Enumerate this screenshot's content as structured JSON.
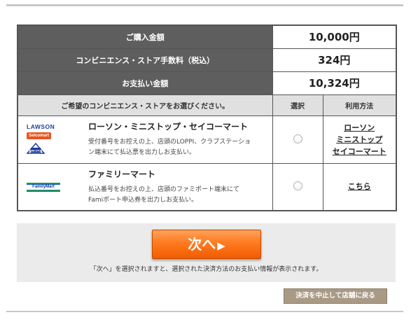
{
  "summary": {
    "purchase_label": "ご購入金額",
    "purchase_value": "10,000円",
    "fee_label": "コンビニエンス・ストア手数料（税込）",
    "fee_value": "324円",
    "total_label": "お支払い金額",
    "total_value": "10,324円"
  },
  "store_table": {
    "header_store": "ご希望のコンビニエンス・ストアをお選びください。",
    "header_select": "選択",
    "header_method": "利用方法",
    "rows": [
      {
        "logos": [
          "LAWSON",
          "Seicomart",
          "MINI STOP"
        ],
        "name": "ローソン・ミニストップ・セイコーマート",
        "desc_line1": "受付番号をお控えの上、店頭のLOPPI、クラブステーショ",
        "desc_line2": "ン端末にて払込票を出力しお支払い。",
        "method_links": [
          "ローソン",
          "ミニストップ",
          "セイコーマート"
        ],
        "selected": false
      },
      {
        "logos": [
          "FamilyMart"
        ],
        "name": "ファミリーマート",
        "desc_line1": "払込番号をお控えの上、店頭のファミポート端末にて",
        "desc_line2": "Famiポート申込券を出力しお支払い。",
        "method_links": [
          "こちら"
        ],
        "selected": false
      }
    ]
  },
  "next": {
    "button_label": "次へ",
    "button_icon": "play-arrow-icon",
    "note": "「次へ」を選択されますと、選択された決済方法のお支払い情報が表示されます。"
  },
  "cancel": {
    "label": "決済を中止して店舗に戻る"
  },
  "colors": {
    "summary_bg": "#5e5e5e",
    "header_bg": "#e0e0e0",
    "next_button": "#ff7a20",
    "cancel_button": "#a89a84",
    "panel_bg": "#ebebeb"
  }
}
